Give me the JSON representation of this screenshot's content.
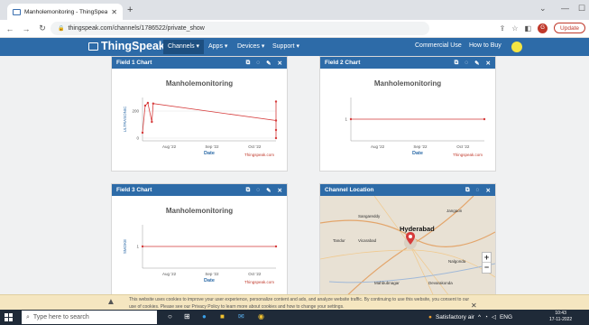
{
  "browser": {
    "tab_title": "Manholemonitoring - ThingSpeak",
    "url": "thingspeak.com/channels/1786522/private_show",
    "update_label": "Update"
  },
  "navbar": {
    "logo": "ThingSpeak",
    "logo_tm": "™",
    "channels": "Channels ▾",
    "apps": "Apps ▾",
    "devices": "Devices ▾",
    "support": "Support ▾",
    "commercial": "Commercial Use",
    "how_to_buy": "How to Buy"
  },
  "panels": {
    "field1": {
      "title": "Field 1 Chart"
    },
    "field2": {
      "title": "Field 2 Chart"
    },
    "field3": {
      "title": "Field 3 Chart"
    },
    "location": {
      "title": "Channel Location"
    },
    "timestamp_label": "Thingspeak.com"
  },
  "chart_data": [
    {
      "type": "line",
      "title": "Manholemonitoring",
      "xlabel": "Date",
      "ylabel": "ULTRASONIC",
      "x_ticks": [
        "Aug '22",
        "Sep '22",
        "Oct '22"
      ],
      "y_ticks": [
        0,
        200
      ],
      "ylim": [
        -20,
        300
      ],
      "series": [
        {
          "points": [
            [
              0.0,
              40
            ],
            [
              0.02,
              240
            ],
            [
              0.04,
              260
            ],
            [
              0.07,
              120
            ],
            [
              0.08,
              255
            ],
            [
              1.0,
              130
            ],
            [
              1.0,
              0
            ],
            [
              1.0,
              270
            ],
            [
              1.0,
              60
            ]
          ]
        }
      ]
    },
    {
      "type": "line",
      "title": "Manholemonitoring",
      "xlabel": "Date",
      "ylabel": "",
      "x_ticks": [
        "Aug '22",
        "Sep '22",
        "Oct '22"
      ],
      "y_ticks": [
        1
      ],
      "series": [
        {
          "points": [
            [
              0.0,
              1
            ],
            [
              1.0,
              1
            ]
          ]
        }
      ]
    },
    {
      "type": "line",
      "title": "Manholemonitoring",
      "xlabel": "Date",
      "ylabel": "SMOKE",
      "x_ticks": [
        "Aug '22",
        "Sep '22",
        "Oct '22"
      ],
      "y_ticks": [
        1
      ],
      "series": [
        {
          "points": [
            [
              0.0,
              1
            ],
            [
              1.0,
              1
            ]
          ]
        }
      ]
    }
  ],
  "map": {
    "city": "Hyderabad",
    "places": [
      "Sangareddy",
      "Jangaon",
      "Tandur",
      "Vicarabad",
      "Nalgonda",
      "Mahbubnagar",
      "Devarakonda"
    ]
  },
  "cookie": {
    "line1": "This website uses cookies to improve your user experience, personalize content and ads, and analyze website traffic. By continuing to use this website, you consent to our",
    "line2": "use of cookies. Please see our Privacy Policy to learn more about cookies and how to change your settings."
  },
  "taskbar": {
    "search_placeholder": "Type here to search",
    "weather": "Satisfactory air",
    "lang": "ENG",
    "time": "10:43",
    "date": "17-11-2022"
  }
}
